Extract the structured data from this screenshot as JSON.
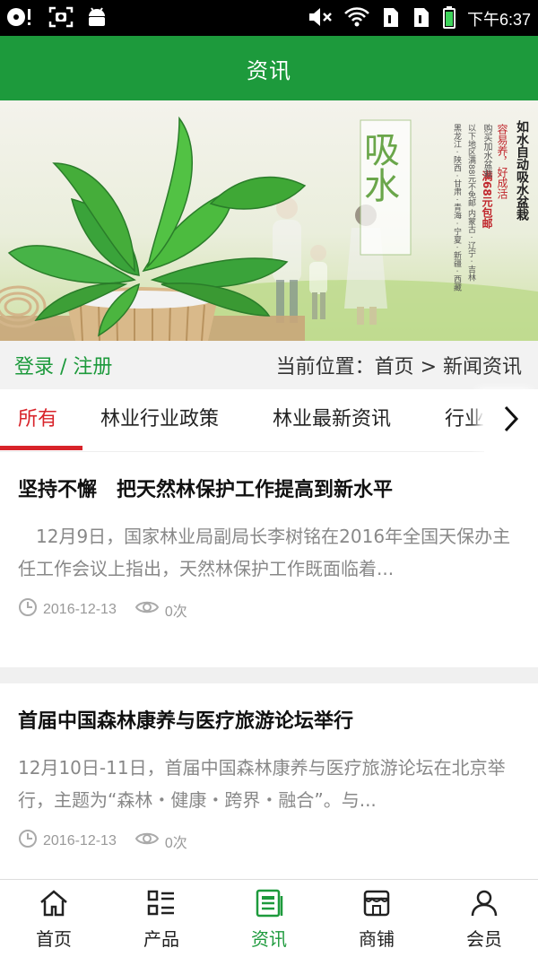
{
  "status_bar": {
    "time": "下午6:37",
    "left_icons": [
      "media-record-icon",
      "screenshot-icon",
      "android-icon"
    ],
    "right_icons": [
      "mute-icon",
      "wifi-icon",
      "sim1-icon",
      "sim2-icon",
      "battery-icon"
    ]
  },
  "header": {
    "title": "资讯"
  },
  "banner": {
    "headline": "如水自动吸水盆栽",
    "tagline": "容易养，好成活",
    "shipping_note": "购买加水盆栽",
    "promo": "满68元包邮",
    "region_note_1": "黑龙江 · 陕西 · 甘肃 · 青海 · 宁夏 · 新疆 · 西藏",
    "region_note_2": "以下地区满88元不免邮 内蒙古 · 辽宁 · 吉林",
    "big_chars": "吸水"
  },
  "breadcrumb": {
    "login_label": "登录 / 注册",
    "location": "当前位置：首页 > 新闻资讯"
  },
  "tabs": [
    {
      "label": "所有",
      "active": true
    },
    {
      "label": "林业行业政策",
      "active": false
    },
    {
      "label": "林业最新资讯",
      "active": false
    },
    {
      "label": "行业",
      "active": false
    }
  ],
  "articles": [
    {
      "title": "坚持不懈　把天然林保护工作提高到新水平",
      "summary": "　12月9日，国家林业局副局长李树铭在2016年全国天保办主任工作会议上指出，天然林保护工作既面临着...",
      "date": "2016-12-13",
      "views": "0次"
    },
    {
      "title": "首届中国森林康养与医疗旅游论坛举行",
      "summary": "12月10日-11日，首届中国森林康养与医疗旅游论坛在北京举行，主题为“森林・健康・跨界・融合”。与...",
      "date": "2016-12-13",
      "views": "0次"
    }
  ],
  "bottom_nav": [
    {
      "label": "首页",
      "icon": "home-icon",
      "active": false
    },
    {
      "label": "产品",
      "icon": "grid-list-icon",
      "active": false
    },
    {
      "label": "资讯",
      "icon": "news-icon",
      "active": true
    },
    {
      "label": "商铺",
      "icon": "shop-icon",
      "active": false
    },
    {
      "label": "会员",
      "icon": "user-icon",
      "active": false
    }
  ],
  "colors": {
    "brand_green": "#1d9a3c",
    "active_red": "#d8232a",
    "muted_text": "#888888"
  }
}
